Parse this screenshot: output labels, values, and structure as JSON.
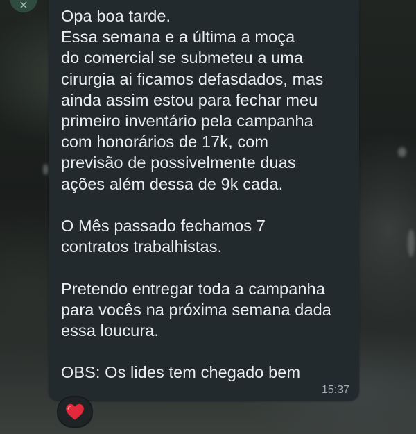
{
  "message": {
    "text": "Opa boa tarde.\nEssa semana e a última a moça\ndo comercial se submeteu a uma\ncirurgia ai ficamos defasdados, mas\nainda assim estou para fechar meu\nprimeiro inventário pela campanha\ncom honorários de 17k, com\nprevisão de possivelmente duas\nações além dessa de 9k cada.\n\nO Mês passado fechamos 7\ncontratos trabalhistas.\n\nPretendo entregar toda a campanha\npara vocês na próxima semana dada\nessa loucura.\n\nOBS: Os lides tem chegado bem",
    "time": "15:37"
  },
  "reaction": {
    "icon": "heart-icon",
    "color": "#e0293a"
  },
  "colors": {
    "bubble": "#232a2e",
    "text": "#e9edef",
    "timestamp": "#a3adb3"
  }
}
